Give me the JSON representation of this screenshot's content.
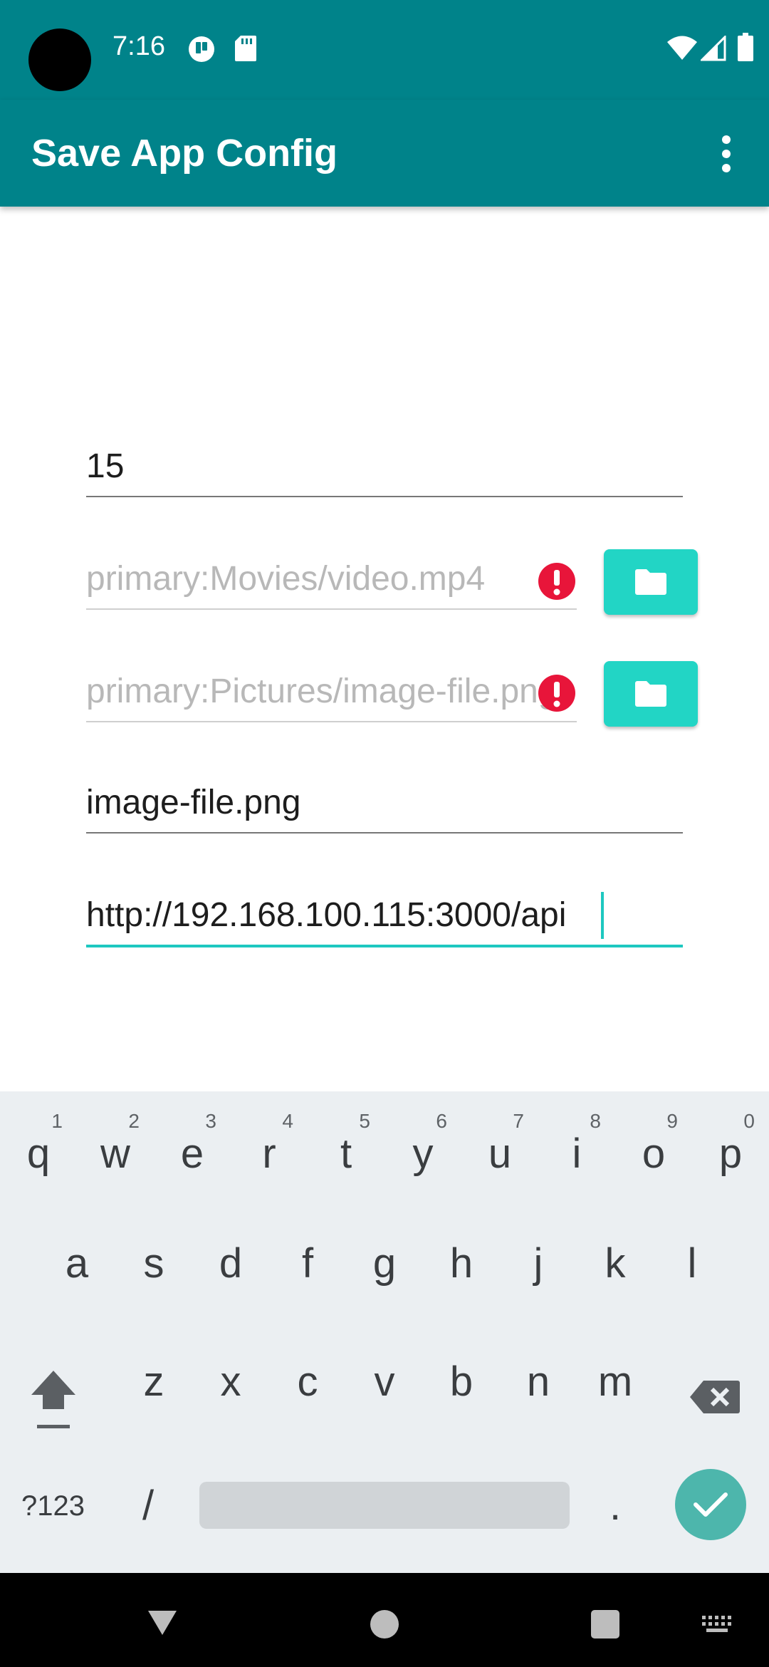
{
  "status_bar": {
    "time": "7:16"
  },
  "app_bar": {
    "title": "Save App Config"
  },
  "form": {
    "interval": {
      "value": "15"
    },
    "video_path": {
      "placeholder": "primary:Movies/video.mp4"
    },
    "image_path": {
      "placeholder": "primary:Pictures/image-file.png"
    },
    "image_name": {
      "value": "image-file.png"
    },
    "api_url": {
      "value": "http://192.168.100.115:3000/api"
    }
  },
  "keyboard": {
    "row1": [
      {
        "key": "q",
        "hint": "1"
      },
      {
        "key": "w",
        "hint": "2"
      },
      {
        "key": "e",
        "hint": "3"
      },
      {
        "key": "r",
        "hint": "4"
      },
      {
        "key": "t",
        "hint": "5"
      },
      {
        "key": "y",
        "hint": "6"
      },
      {
        "key": "u",
        "hint": "7"
      },
      {
        "key": "i",
        "hint": "8"
      },
      {
        "key": "o",
        "hint": "9"
      },
      {
        "key": "p",
        "hint": "0"
      }
    ],
    "row2": [
      "a",
      "s",
      "d",
      "f",
      "g",
      "h",
      "j",
      "k",
      "l"
    ],
    "row3": [
      "z",
      "x",
      "c",
      "v",
      "b",
      "n",
      "m"
    ],
    "symbols_label": "?123",
    "slash_label": "/",
    "period_label": "."
  },
  "colors": {
    "primary": "#00838a",
    "accent": "#22d5c5",
    "error": "#e8153a"
  }
}
